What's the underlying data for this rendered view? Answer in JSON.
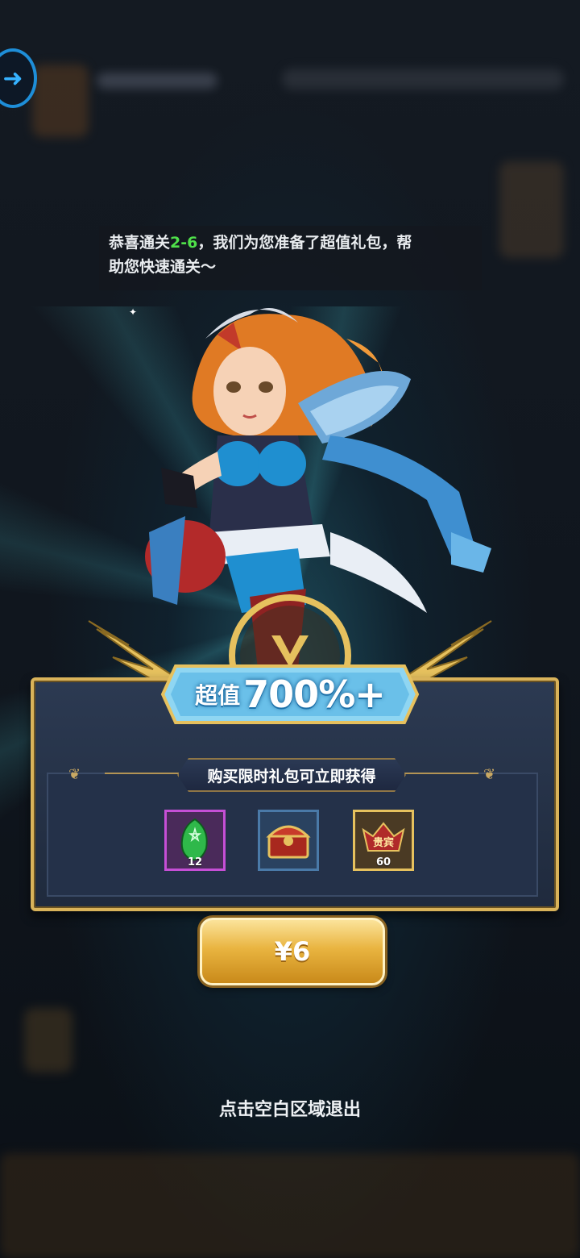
{
  "tip": {
    "prefix": "恭喜通关",
    "stage": "2-6",
    "suffix_line1": "，我们为您准备了超值礼包，帮",
    "line2": "助您快速通关～"
  },
  "banner": {
    "prefix": "超值",
    "value": "700%+"
  },
  "subtitle": "购买限时礼包可立即获得",
  "rewards": [
    {
      "icon": "green-gem-icon",
      "count": "12"
    },
    {
      "icon": "treasure-chest-icon",
      "count": ""
    },
    {
      "icon": "vip-badge-icon",
      "badge_text": "贵宾",
      "count": "60"
    }
  ],
  "price_button": "¥6",
  "exit_hint": "点击空白区域退出",
  "colors": {
    "highlight_green": "#4fe04a",
    "gold": "#d9b35a",
    "accent_blue": "#36b2ff"
  }
}
